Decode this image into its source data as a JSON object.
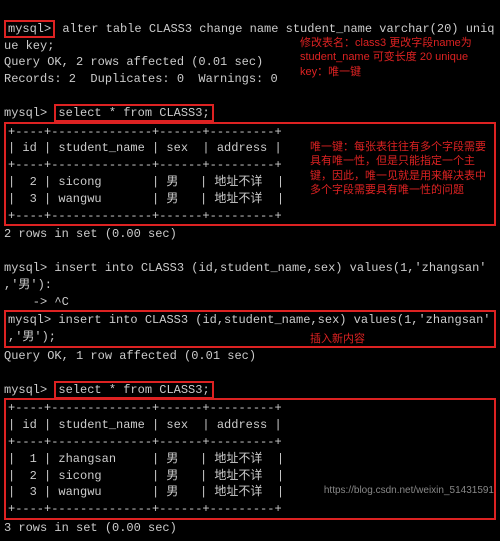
{
  "prompt": "mysql>",
  "cont": "    ->",
  "cmd_alter": "alter table CLASS3 change name student_name varchar(20) uniq",
  "cmd_alter2": "ue key;",
  "res_alter_ok": "Query OK, 2 rows affected (0.01 sec)",
  "res_alter_rec": "Records: 2  Duplicates: 0  Warnings: 0",
  "cmd_sel1": "select * from CLASS3;",
  "table_border": "+----+--------------+------+---------+",
  "table_header": "| id | student_name | sex  | address |",
  "row_sicong": "|  2 | sicong       | 男   | 地址不详  |",
  "row_wangwu": "|  3 | wangwu       | 男   | 地址不详  |",
  "res_sel1": "2 rows in set (0.00 sec)",
  "cmd_ins1a": "insert into CLASS3 (id,student_name,sex) values(1,'zhangsan'",
  "cmd_ins1b": ",'男'):",
  "cmd_ins1c": "^C",
  "cmd_ins2a": "insert into CLASS3 (id,student_name,sex) values(1,'zhangsan'",
  "cmd_ins2b": ",'男');",
  "res_ins_ok": "Query OK, 1 row affected (0.01 sec)",
  "cmd_sel2": "select * from CLASS3;",
  "row_zhang": "|  1 | zhangsan     | 男   | 地址不详  |",
  "res_sel2": "3 rows in set (0.00 sec)",
  "annot1": "修改表名：class3 更改字段name为 student_name 可变长度 20 unique key：唯一键",
  "annot2": "唯一键：每张表往往有多个字段需要具有唯一性，但是只能指定一个主键，因此，唯一见就是用来解决表中多个字段需要具有唯一性的问题",
  "annot3": "插入新内容",
  "watermark": "https://blog.csdn.net/weixin_51431591"
}
